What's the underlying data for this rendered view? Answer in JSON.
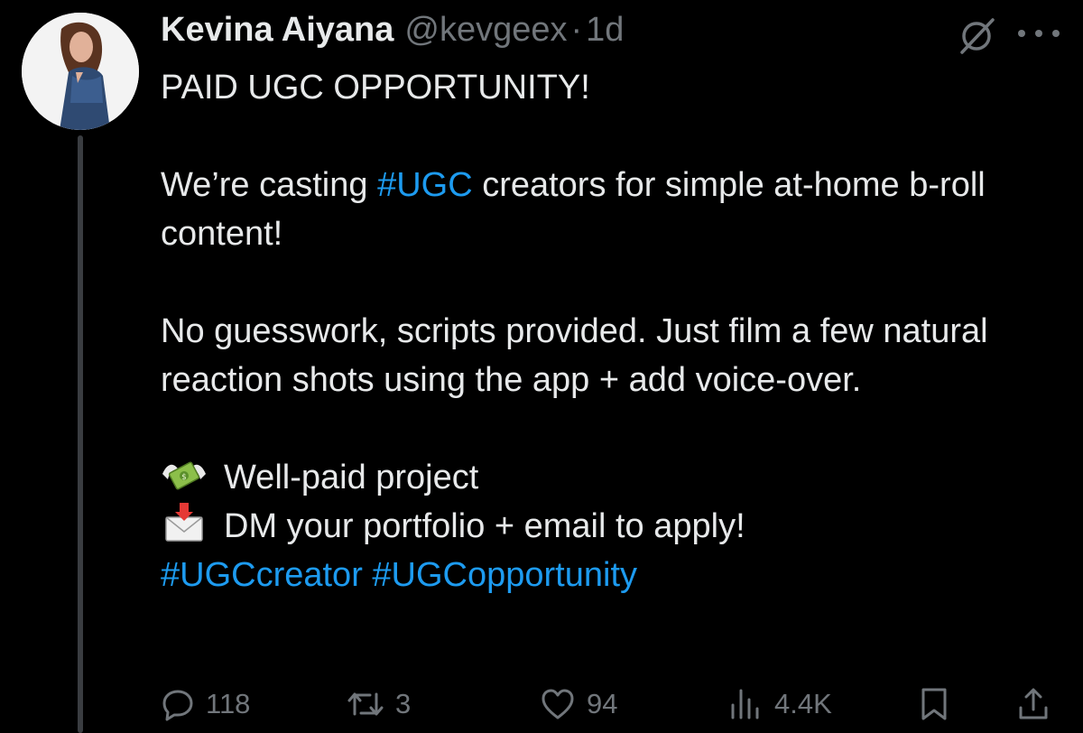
{
  "tweet": {
    "author": {
      "display_name": "Kevina Aiyana",
      "handle": "@kevgeex",
      "separator": "·",
      "time": "1d"
    },
    "lines": {
      "title": "PAID UGC OPPORTUNITY!",
      "p1_before": "We’re casting ",
      "p1_tag": "#UGC",
      "p1_after": " creators for simple at-home b-roll content!",
      "p2": "No guesswork, scripts provided. Just film a few natural reaction shots using the app + add voice-over.",
      "bullet1": "Well-paid project",
      "bullet2": "DM your portfolio + email to apply!",
      "tag1": "#UGCcreator",
      "tag2": "#UGCopportunity"
    },
    "stats": {
      "replies": "118",
      "reposts": "3",
      "likes": "94",
      "views": "4.4K"
    }
  },
  "icons": {
    "reply": "reply-icon",
    "repost": "repost-icon",
    "like": "heart-icon",
    "views": "views-icon",
    "bookmark": "bookmark-icon",
    "share": "share-icon",
    "grok": "grok-icon",
    "more": "more-icon",
    "bullet1": "money-with-wings-icon",
    "bullet2": "envelope-with-arrow-icon"
  },
  "colors": {
    "background": "#000000",
    "text": "#e7e9ea",
    "muted": "#71767b",
    "link": "#1d9bf0"
  }
}
